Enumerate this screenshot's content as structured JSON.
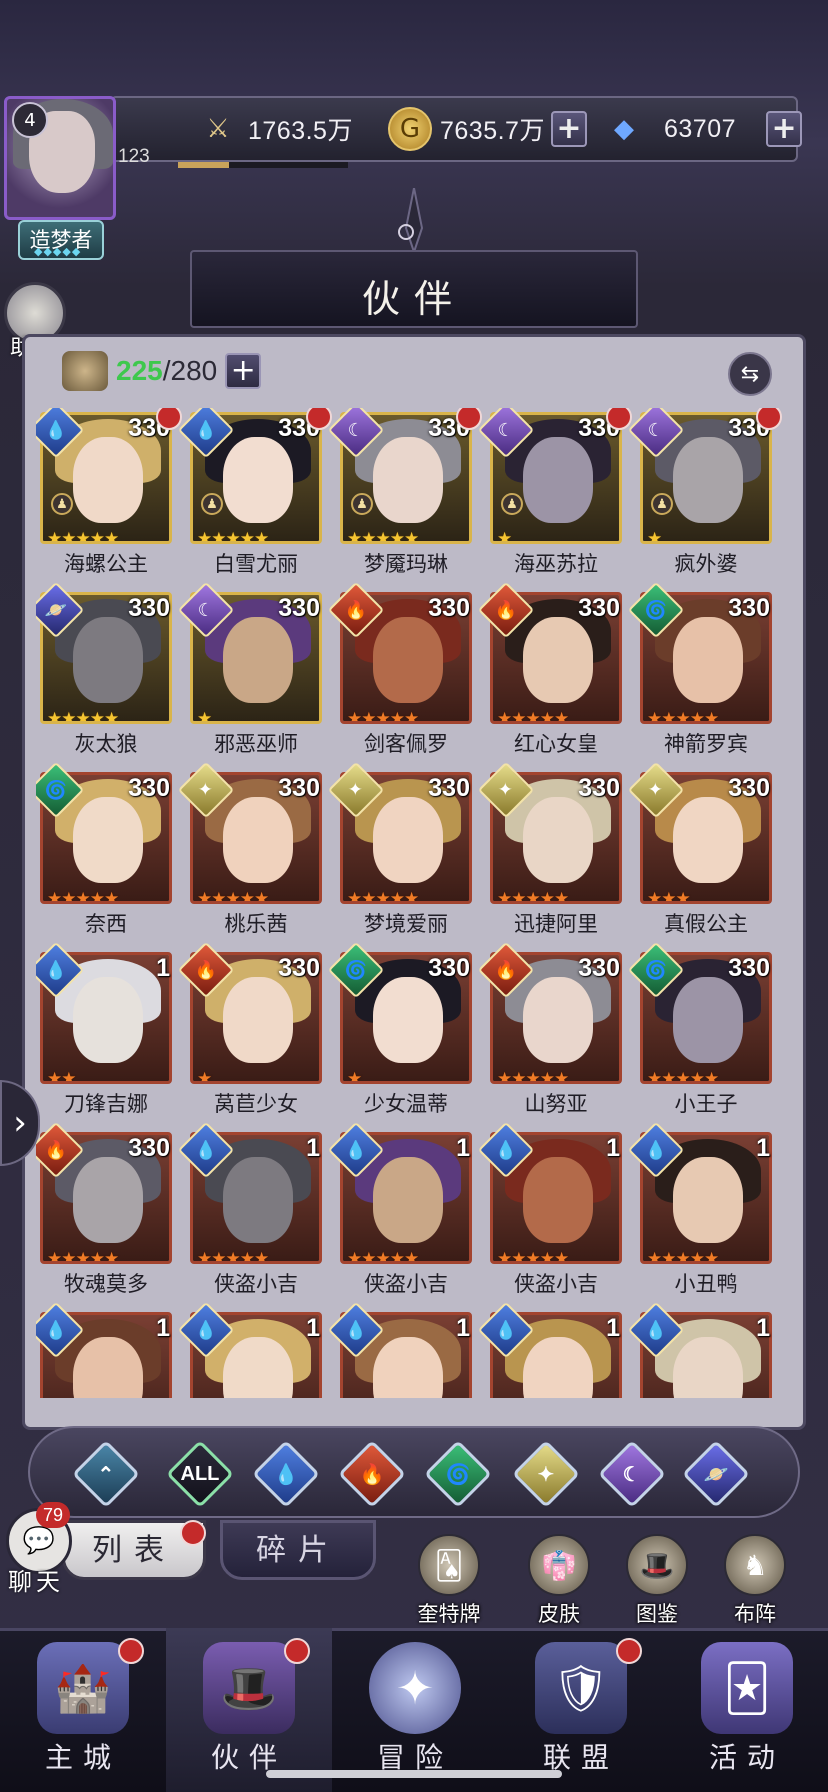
{
  "player": {
    "level": "4",
    "exp_value": "123",
    "exp_progress": 0.3,
    "title": "造梦者",
    "helper_label": "助手"
  },
  "resources": {
    "power": "1763.5万",
    "gold": "7635.7万",
    "diamonds": "63707"
  },
  "header": {
    "title": "伙伴"
  },
  "roster": {
    "current": "225",
    "separator": "/",
    "max": "280"
  },
  "companions": [
    {
      "name": "海螺公主",
      "level": "330",
      "element": "water",
      "stars": 5,
      "star_color": "gold",
      "border": "gold",
      "red_dot": true,
      "chess": true
    },
    {
      "name": "白雪尤丽",
      "level": "330",
      "element": "water",
      "stars": 5,
      "star_color": "gold",
      "border": "gold",
      "red_dot": true,
      "chess": true
    },
    {
      "name": "梦魇玛琳",
      "level": "330",
      "element": "moon",
      "stars": 5,
      "star_color": "gold",
      "border": "gold",
      "red_dot": true,
      "chess": true
    },
    {
      "name": "海巫苏拉",
      "level": "330",
      "element": "moon",
      "stars": 1,
      "star_color": "gold",
      "border": "gold",
      "red_dot": true,
      "chess": true
    },
    {
      "name": "疯外婆",
      "level": "330",
      "element": "moon",
      "stars": 1,
      "star_color": "gold",
      "border": "gold",
      "red_dot": true,
      "chess": true
    },
    {
      "name": "灰太狼",
      "level": "330",
      "element": "cosmos",
      "stars": 5,
      "star_color": "gold",
      "border": "gold",
      "red_dot": false,
      "chess": false
    },
    {
      "name": "邪恶巫师",
      "level": "330",
      "element": "moon",
      "stars": 1,
      "star_color": "gold",
      "border": "gold",
      "red_dot": false,
      "chess": false
    },
    {
      "name": "剑客佩罗",
      "level": "330",
      "element": "fire",
      "stars": 5,
      "star_color": "orange",
      "border": "red",
      "red_dot": false,
      "chess": false
    },
    {
      "name": "红心女皇",
      "level": "330",
      "element": "fire",
      "stars": 5,
      "star_color": "orange",
      "border": "red",
      "red_dot": false,
      "chess": false
    },
    {
      "name": "神箭罗宾",
      "level": "330",
      "element": "wind",
      "stars": 5,
      "star_color": "orange",
      "border": "red",
      "red_dot": false,
      "chess": false
    },
    {
      "name": "奈西",
      "level": "330",
      "element": "wind",
      "stars": 5,
      "star_color": "orange",
      "border": "red",
      "red_dot": false,
      "chess": false
    },
    {
      "name": "桃乐茜",
      "level": "330",
      "element": "light",
      "stars": 5,
      "star_color": "orange",
      "border": "red",
      "red_dot": false,
      "chess": false
    },
    {
      "name": "梦境爱丽",
      "level": "330",
      "element": "light",
      "stars": 5,
      "star_color": "orange",
      "border": "red",
      "red_dot": false,
      "chess": false
    },
    {
      "name": "迅捷阿里",
      "level": "330",
      "element": "light",
      "stars": 5,
      "star_color": "orange",
      "border": "red",
      "red_dot": false,
      "chess": false
    },
    {
      "name": "真假公主",
      "level": "330",
      "element": "light",
      "stars": 3,
      "star_color": "orange",
      "border": "red",
      "red_dot": false,
      "chess": false
    },
    {
      "name": "刀锋吉娜",
      "level": "1",
      "element": "water",
      "stars": 2,
      "star_color": "orange",
      "border": "red",
      "red_dot": false,
      "chess": false
    },
    {
      "name": "莴苣少女",
      "level": "330",
      "element": "fire",
      "stars": 1,
      "star_color": "orange",
      "border": "red",
      "red_dot": false,
      "chess": false
    },
    {
      "name": "少女温蒂",
      "level": "330",
      "element": "wind",
      "stars": 1,
      "star_color": "orange",
      "border": "red",
      "red_dot": false,
      "chess": false
    },
    {
      "name": "山努亚",
      "level": "330",
      "element": "fire",
      "stars": 5,
      "star_color": "orange",
      "border": "red",
      "red_dot": false,
      "chess": false
    },
    {
      "name": "小王子",
      "level": "330",
      "element": "wind",
      "stars": 5,
      "star_color": "orange",
      "border": "red",
      "red_dot": false,
      "chess": false
    },
    {
      "name": "牧魂莫多",
      "level": "330",
      "element": "fire",
      "stars": 5,
      "star_color": "orange",
      "border": "red",
      "red_dot": false,
      "chess": false
    },
    {
      "name": "侠盗小吉",
      "level": "1",
      "element": "water",
      "stars": 5,
      "star_color": "orange",
      "border": "red",
      "red_dot": false,
      "chess": false
    },
    {
      "name": "侠盗小吉",
      "level": "1",
      "element": "water",
      "stars": 5,
      "star_color": "orange",
      "border": "red",
      "red_dot": false,
      "chess": false
    },
    {
      "name": "侠盗小吉",
      "level": "1",
      "element": "water",
      "stars": 5,
      "star_color": "orange",
      "border": "red",
      "red_dot": false,
      "chess": false
    },
    {
      "name": "小丑鸭",
      "level": "1",
      "element": "water",
      "stars": 5,
      "star_color": "orange",
      "border": "red",
      "red_dot": false,
      "chess": false
    },
    {
      "name": "",
      "level": "1",
      "element": "water",
      "stars": 0,
      "star_color": "orange",
      "border": "red",
      "red_dot": false,
      "chess": false
    },
    {
      "name": "",
      "level": "1",
      "element": "water",
      "stars": 0,
      "star_color": "orange",
      "border": "red",
      "red_dot": false,
      "chess": false
    },
    {
      "name": "",
      "level": "1",
      "element": "water",
      "stars": 0,
      "star_color": "orange",
      "border": "red",
      "red_dot": false,
      "chess": false
    },
    {
      "name": "",
      "level": "1",
      "element": "water",
      "stars": 0,
      "star_color": "orange",
      "border": "red",
      "red_dot": false,
      "chess": false
    },
    {
      "name": "",
      "level": "1",
      "element": "water",
      "stars": 0,
      "star_color": "orange",
      "border": "red",
      "red_dot": false,
      "chess": false
    }
  ],
  "filters": [
    {
      "id": "favorite",
      "label": ""
    },
    {
      "id": "all",
      "label": "ALL"
    },
    {
      "id": "water",
      "label": ""
    },
    {
      "id": "fire",
      "label": ""
    },
    {
      "id": "wind",
      "label": ""
    },
    {
      "id": "light",
      "label": ""
    },
    {
      "id": "moon",
      "label": ""
    },
    {
      "id": "cosmos",
      "label": ""
    }
  ],
  "tabs": {
    "list": "列表",
    "fragments": "碎片"
  },
  "chat": {
    "badge": "79",
    "label": "聊天"
  },
  "tools": [
    "奎特牌",
    "皮肤",
    "图鉴",
    "布阵"
  ],
  "nav": [
    {
      "label": "主城",
      "red_dot": true,
      "active": false
    },
    {
      "label": "伙伴",
      "red_dot": true,
      "active": true
    },
    {
      "label": "冒险",
      "red_dot": false,
      "active": false
    },
    {
      "label": "联盟",
      "red_dot": true,
      "active": false
    },
    {
      "label": "活动",
      "red_dot": false,
      "active": false
    }
  ],
  "colors": {
    "accent_red": "#c42a2a",
    "roster_green": "#3ec84d",
    "star_gold": "#f5c431",
    "star_orange": "#f07b26"
  }
}
